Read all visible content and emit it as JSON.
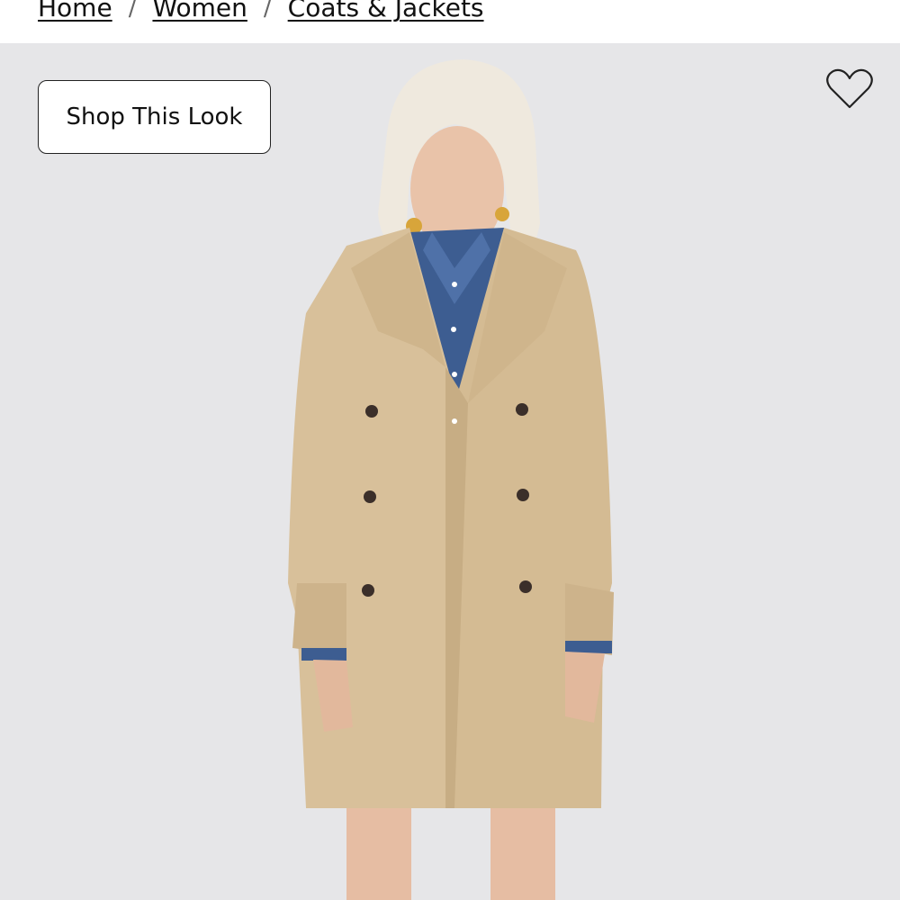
{
  "breadcrumb": {
    "items": [
      {
        "label": "Home"
      },
      {
        "label": "Women"
      },
      {
        "label": "Coats & Jackets"
      }
    ],
    "separator": "/"
  },
  "hero": {
    "shop_look_label": "Shop This Look",
    "favorite_icon": "heart-outline-icon",
    "background_color": "#e6e6e8"
  }
}
